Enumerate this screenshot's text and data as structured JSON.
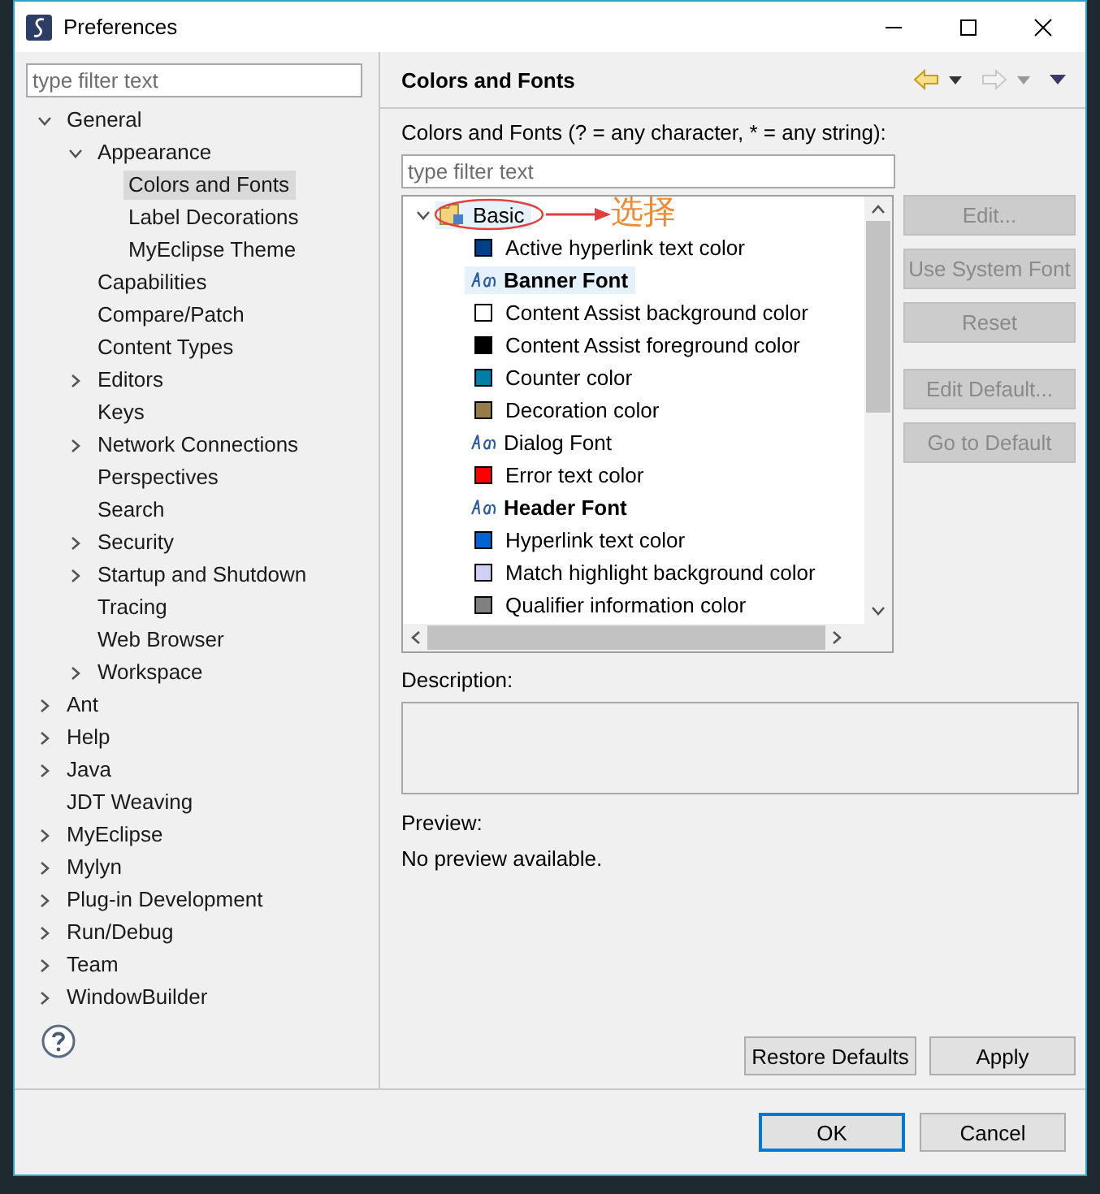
{
  "window": {
    "title": "Preferences"
  },
  "sidebar": {
    "filter": {
      "placeholder": "type filter text"
    },
    "items": [
      {
        "label": "General",
        "expanded": true,
        "selected": false,
        "children": [
          {
            "label": "Appearance",
            "expanded": true,
            "selected": false,
            "children": [
              {
                "label": "Colors and Fonts",
                "selected": true
              },
              {
                "label": "Label Decorations",
                "selected": false
              },
              {
                "label": "MyEclipse Theme",
                "selected": false
              }
            ]
          },
          {
            "label": "Capabilities",
            "selected": false
          },
          {
            "label": "Compare/Patch",
            "selected": false
          },
          {
            "label": "Content Types",
            "selected": false
          },
          {
            "label": "Editors",
            "expanded": false,
            "selected": false
          },
          {
            "label": "Keys",
            "selected": false
          },
          {
            "label": "Network Connections",
            "expanded": false,
            "selected": false
          },
          {
            "label": "Perspectives",
            "selected": false
          },
          {
            "label": "Search",
            "selected": false
          },
          {
            "label": "Security",
            "expanded": false,
            "selected": false
          },
          {
            "label": "Startup and Shutdown",
            "expanded": false,
            "selected": false
          },
          {
            "label": "Tracing",
            "selected": false
          },
          {
            "label": "Web Browser",
            "selected": false
          },
          {
            "label": "Workspace",
            "expanded": false,
            "selected": false
          }
        ]
      },
      {
        "label": "Ant",
        "expanded": false,
        "selected": false
      },
      {
        "label": "Help",
        "expanded": false,
        "selected": false
      },
      {
        "label": "Java",
        "expanded": false,
        "selected": false
      },
      {
        "label": "JDT Weaving",
        "selected": false
      },
      {
        "label": "MyEclipse",
        "expanded": false,
        "selected": false
      },
      {
        "label": "Mylyn",
        "expanded": false,
        "selected": false
      },
      {
        "label": "Plug-in Development",
        "expanded": false,
        "selected": false
      },
      {
        "label": "Run/Debug",
        "expanded": false,
        "selected": false
      },
      {
        "label": "Team",
        "expanded": false,
        "selected": false
      },
      {
        "label": "WindowBuilder",
        "expanded": false,
        "selected": false
      }
    ]
  },
  "page": {
    "title": "Colors and Fonts",
    "filter_label": "Colors and Fonts (? = any character, * = any string):",
    "filter": {
      "placeholder": "type filter text"
    },
    "categories": [
      {
        "label": "Basic",
        "expanded": true,
        "selected": true,
        "children": [
          {
            "kind": "color",
            "label": "Active hyperlink text color",
            "color": "#003f8a",
            "selected": false
          },
          {
            "kind": "font",
            "label": "Banner Font",
            "bold": true,
            "selected": true
          },
          {
            "kind": "color",
            "label": "Content Assist background color",
            "color": "#ffffff",
            "selected": false
          },
          {
            "kind": "color",
            "label": "Content Assist foreground color",
            "color": "#000000",
            "selected": false
          },
          {
            "kind": "color",
            "label": "Counter color",
            "color": "#0080a8",
            "selected": false
          },
          {
            "kind": "color",
            "label": "Decoration color",
            "color": "#957d47",
            "selected": false
          },
          {
            "kind": "font",
            "label": "Dialog Font",
            "bold": false,
            "selected": false
          },
          {
            "kind": "color",
            "label": "Error text color",
            "color": "#ff0000",
            "selected": false
          },
          {
            "kind": "font",
            "label": "Header Font",
            "bold": true,
            "selected": false
          },
          {
            "kind": "color",
            "label": "Hyperlink text color",
            "color": "#0064d2",
            "selected": false
          },
          {
            "kind": "color",
            "label": "Match highlight background color",
            "color": "#d0d0f5",
            "selected": false
          },
          {
            "kind": "color",
            "label": "Qualifier information color",
            "color": "#808080",
            "selected": false
          }
        ]
      }
    ],
    "annotation": {
      "text": "选择"
    },
    "side_buttons": [
      {
        "label": "Edit...",
        "disabled": true
      },
      {
        "label": "Use System Font",
        "disabled": true
      },
      {
        "label": "Reset",
        "disabled": true
      },
      {
        "label": "Edit Default...",
        "disabled": true
      },
      {
        "label": "Go to Default",
        "disabled": true
      }
    ],
    "description_label": "Description:",
    "preview_label": "Preview:",
    "preview_text": "No preview available.",
    "buttons": [
      "Restore Defaults",
      "Apply"
    ]
  },
  "footer": {
    "buttons": [
      {
        "label": "OK",
        "default": true
      },
      {
        "label": "Cancel",
        "default": false
      }
    ]
  }
}
